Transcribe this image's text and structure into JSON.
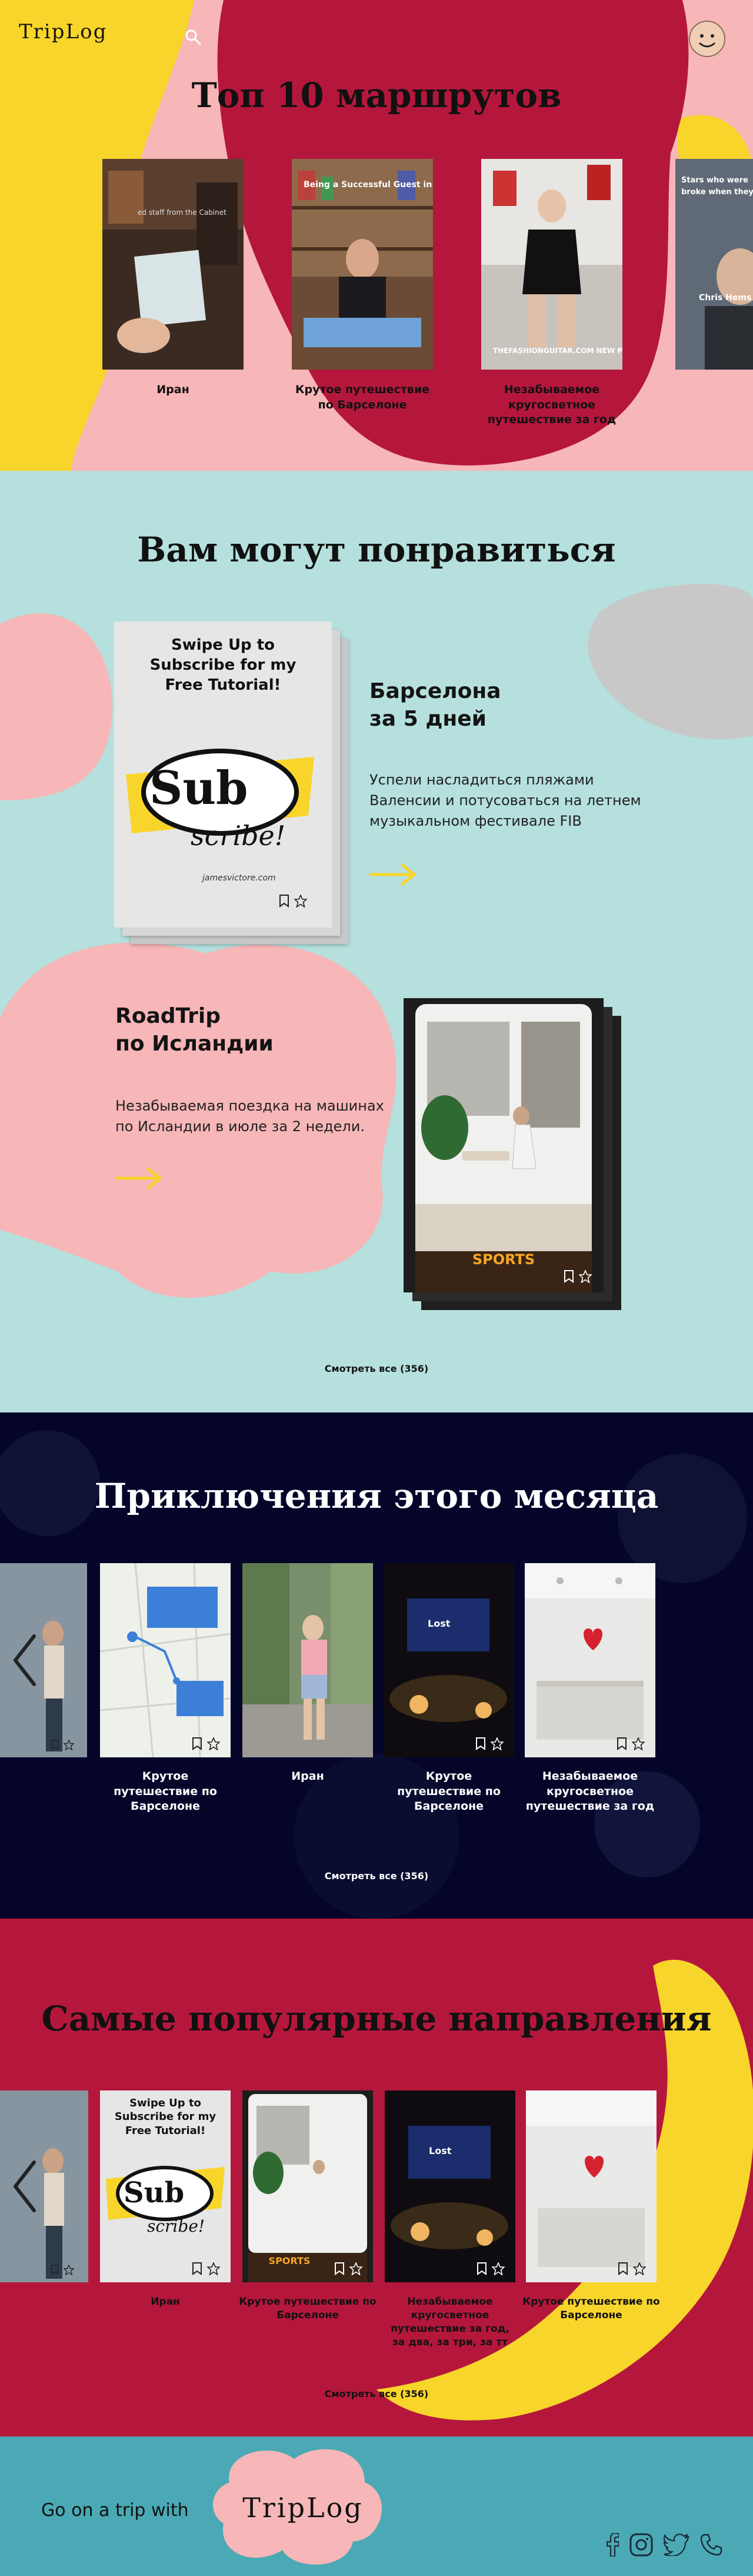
{
  "header": {
    "logo_text": "TripLog",
    "icons": [
      "search-icon",
      "smiley-avatar-icon"
    ]
  },
  "top_routes": {
    "title": "Топ 10 маршрутов",
    "cards": [
      {
        "caption": "Иран",
        "image_text": "ed staff from the Cabinet"
      },
      {
        "caption": "Крутое путешествие по Барселоне",
        "image_text": "Being a Successful Guest in the Cabinet Welcome"
      },
      {
        "caption": "Незабываемое кругосветное путешествие за год",
        "image_text": "THEFASHIONGUITAR.COM NEW POST UP"
      },
      {
        "caption": "",
        "image_text": "Stars who were broke when they... Chris Hemsworth"
      }
    ]
  },
  "may_like": {
    "title": "Вам могут понравиться",
    "cards": [
      {
        "title_line1": "Барселона",
        "title_line2": "за 5 дней",
        "description": "Успели насладиться пляжами Валенсии и потусоваться на летнем музыкальном фестивале FIB",
        "image_text": "Swipe Up to Subscribe for my Free Tutorial!",
        "image_logo": "Sub scribe!",
        "image_footer": "jamesvictore.com"
      },
      {
        "title_line1": "RoadTrip",
        "title_line2": "по Исландии",
        "description": "Незабываемая поездка на машинах по Исландии в июле за 2 недели.",
        "image_text": "SPORTS"
      }
    ],
    "see_all": "Смотреть все (356)"
  },
  "adventures": {
    "title": "Приключения этого месяца",
    "cards": [
      {
        "caption": ""
      },
      {
        "caption": "Крутое путешествие по Барселоне"
      },
      {
        "caption": "Иран"
      },
      {
        "caption": "Крутое путешествие по Барселоне"
      },
      {
        "caption": "Незабываемое кругосветное путешествие за год"
      }
    ],
    "see_all": "Смотреть все (356)"
  },
  "popular": {
    "title": "Самые популярные направления",
    "cards": [
      {
        "caption": ""
      },
      {
        "caption": "Иран",
        "image_text": "Swipe Up to Subscribe for my Free Tutorial!"
      },
      {
        "caption": "Крутое путешествие по Барселоне",
        "image_text": "SPORTS"
      },
      {
        "caption": "Незабываемое кругосветное путешествие за год, за два, за три, за тт"
      },
      {
        "caption": "Крутое путешествие по Барселоне"
      }
    ],
    "see_all": "Смотреть все (356)"
  },
  "footer": {
    "tagline": "Go on a trip with",
    "logo_text": "TripLog",
    "social_icons": [
      "facebook-icon",
      "instagram-icon",
      "twitter-icon",
      "phone-icon"
    ]
  },
  "colors": {
    "crimson": "#b5173c",
    "pink": "#f7b6b8",
    "yellow": "#f8d52a",
    "mint": "#b5e0dd",
    "navy": "#05052a",
    "teal": "#4aa9b4"
  }
}
